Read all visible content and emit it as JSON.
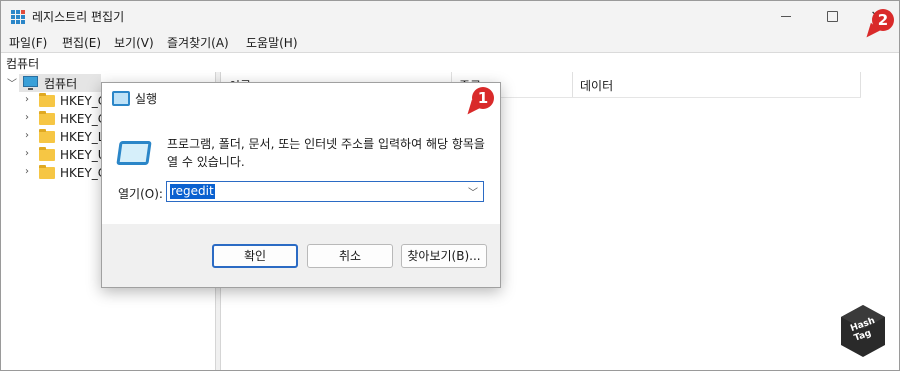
{
  "window": {
    "title": "레지스트리 편집기",
    "min_glyph": "—",
    "max_glyph": "☐",
    "close_glyph": "✕"
  },
  "menu": [
    {
      "label": "파일(F)"
    },
    {
      "label": "편집(E)"
    },
    {
      "label": "보기(V)"
    },
    {
      "label": "즐겨찾기(A)"
    },
    {
      "label": "도움말(H)"
    }
  ],
  "address": "컴퓨터",
  "tree": {
    "root": "컴퓨터",
    "items": [
      {
        "label": "HKEY_C"
      },
      {
        "label": "HKEY_C"
      },
      {
        "label": "HKEY_LC"
      },
      {
        "label": "HKEY_U"
      },
      {
        "label": "HKEY_C"
      }
    ]
  },
  "list": {
    "columns": [
      "이름",
      "종류",
      "데이터"
    ]
  },
  "run_dialog": {
    "title": "실행",
    "message": "프로그램, 폴더, 문서, 또는 인터넷 주소를 입력하여 해당 항목을 열 수 있습니다.",
    "open_label": "열기(O):",
    "input_value": "regedit",
    "ok_label": "확인",
    "cancel_label": "취소",
    "browse_label": "찾아보기(B)..."
  },
  "annotations": {
    "badge1": "1",
    "badge2": "2",
    "color": "#d92a2a"
  },
  "watermark": {
    "text_line1": "Hash",
    "text_line2": "Tag"
  },
  "colors": {
    "accent": "#2b6bc4",
    "selection": "#0a61d0",
    "folder": "#f6c644"
  }
}
